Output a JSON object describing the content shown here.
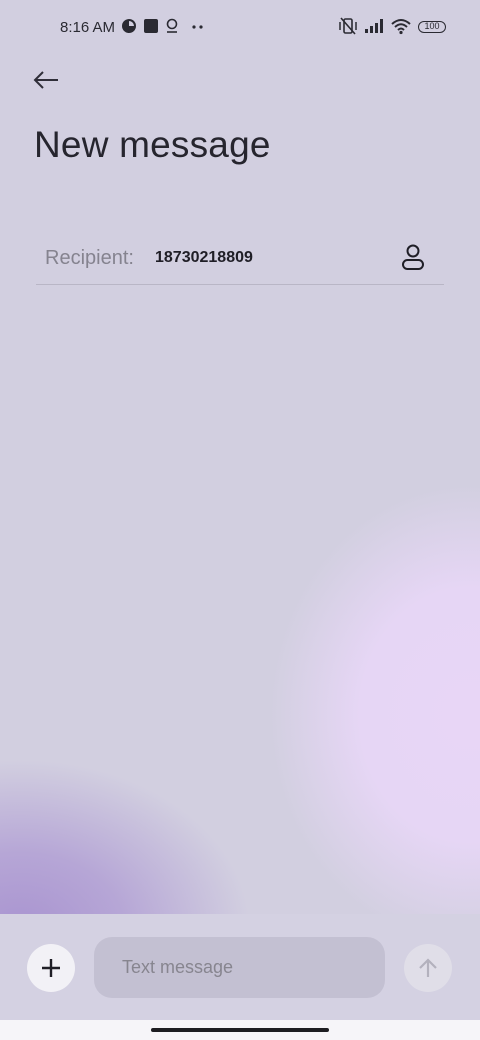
{
  "status_bar": {
    "time": "8:16 AM",
    "battery": "100",
    "left_icons": [
      "notification-icon",
      "square-app-icon",
      "location-icon",
      "more-dots-icon"
    ],
    "right_icons": [
      "vibrate-off-icon",
      "signal-icon",
      "wifi-icon",
      "battery-icon"
    ]
  },
  "header": {
    "back_icon": "back-arrow-icon",
    "title": "New message"
  },
  "recipient": {
    "label": "Recipient:",
    "value": "18730218809",
    "contact_icon": "contact-person-icon"
  },
  "composer": {
    "add_icon": "plus-icon",
    "placeholder": "Text message",
    "send_icon": "send-arrow-icon"
  },
  "colors": {
    "background": "#d2cfe0",
    "accent_purple": "#a994d0",
    "accent_pink": "#e8d6f6"
  }
}
